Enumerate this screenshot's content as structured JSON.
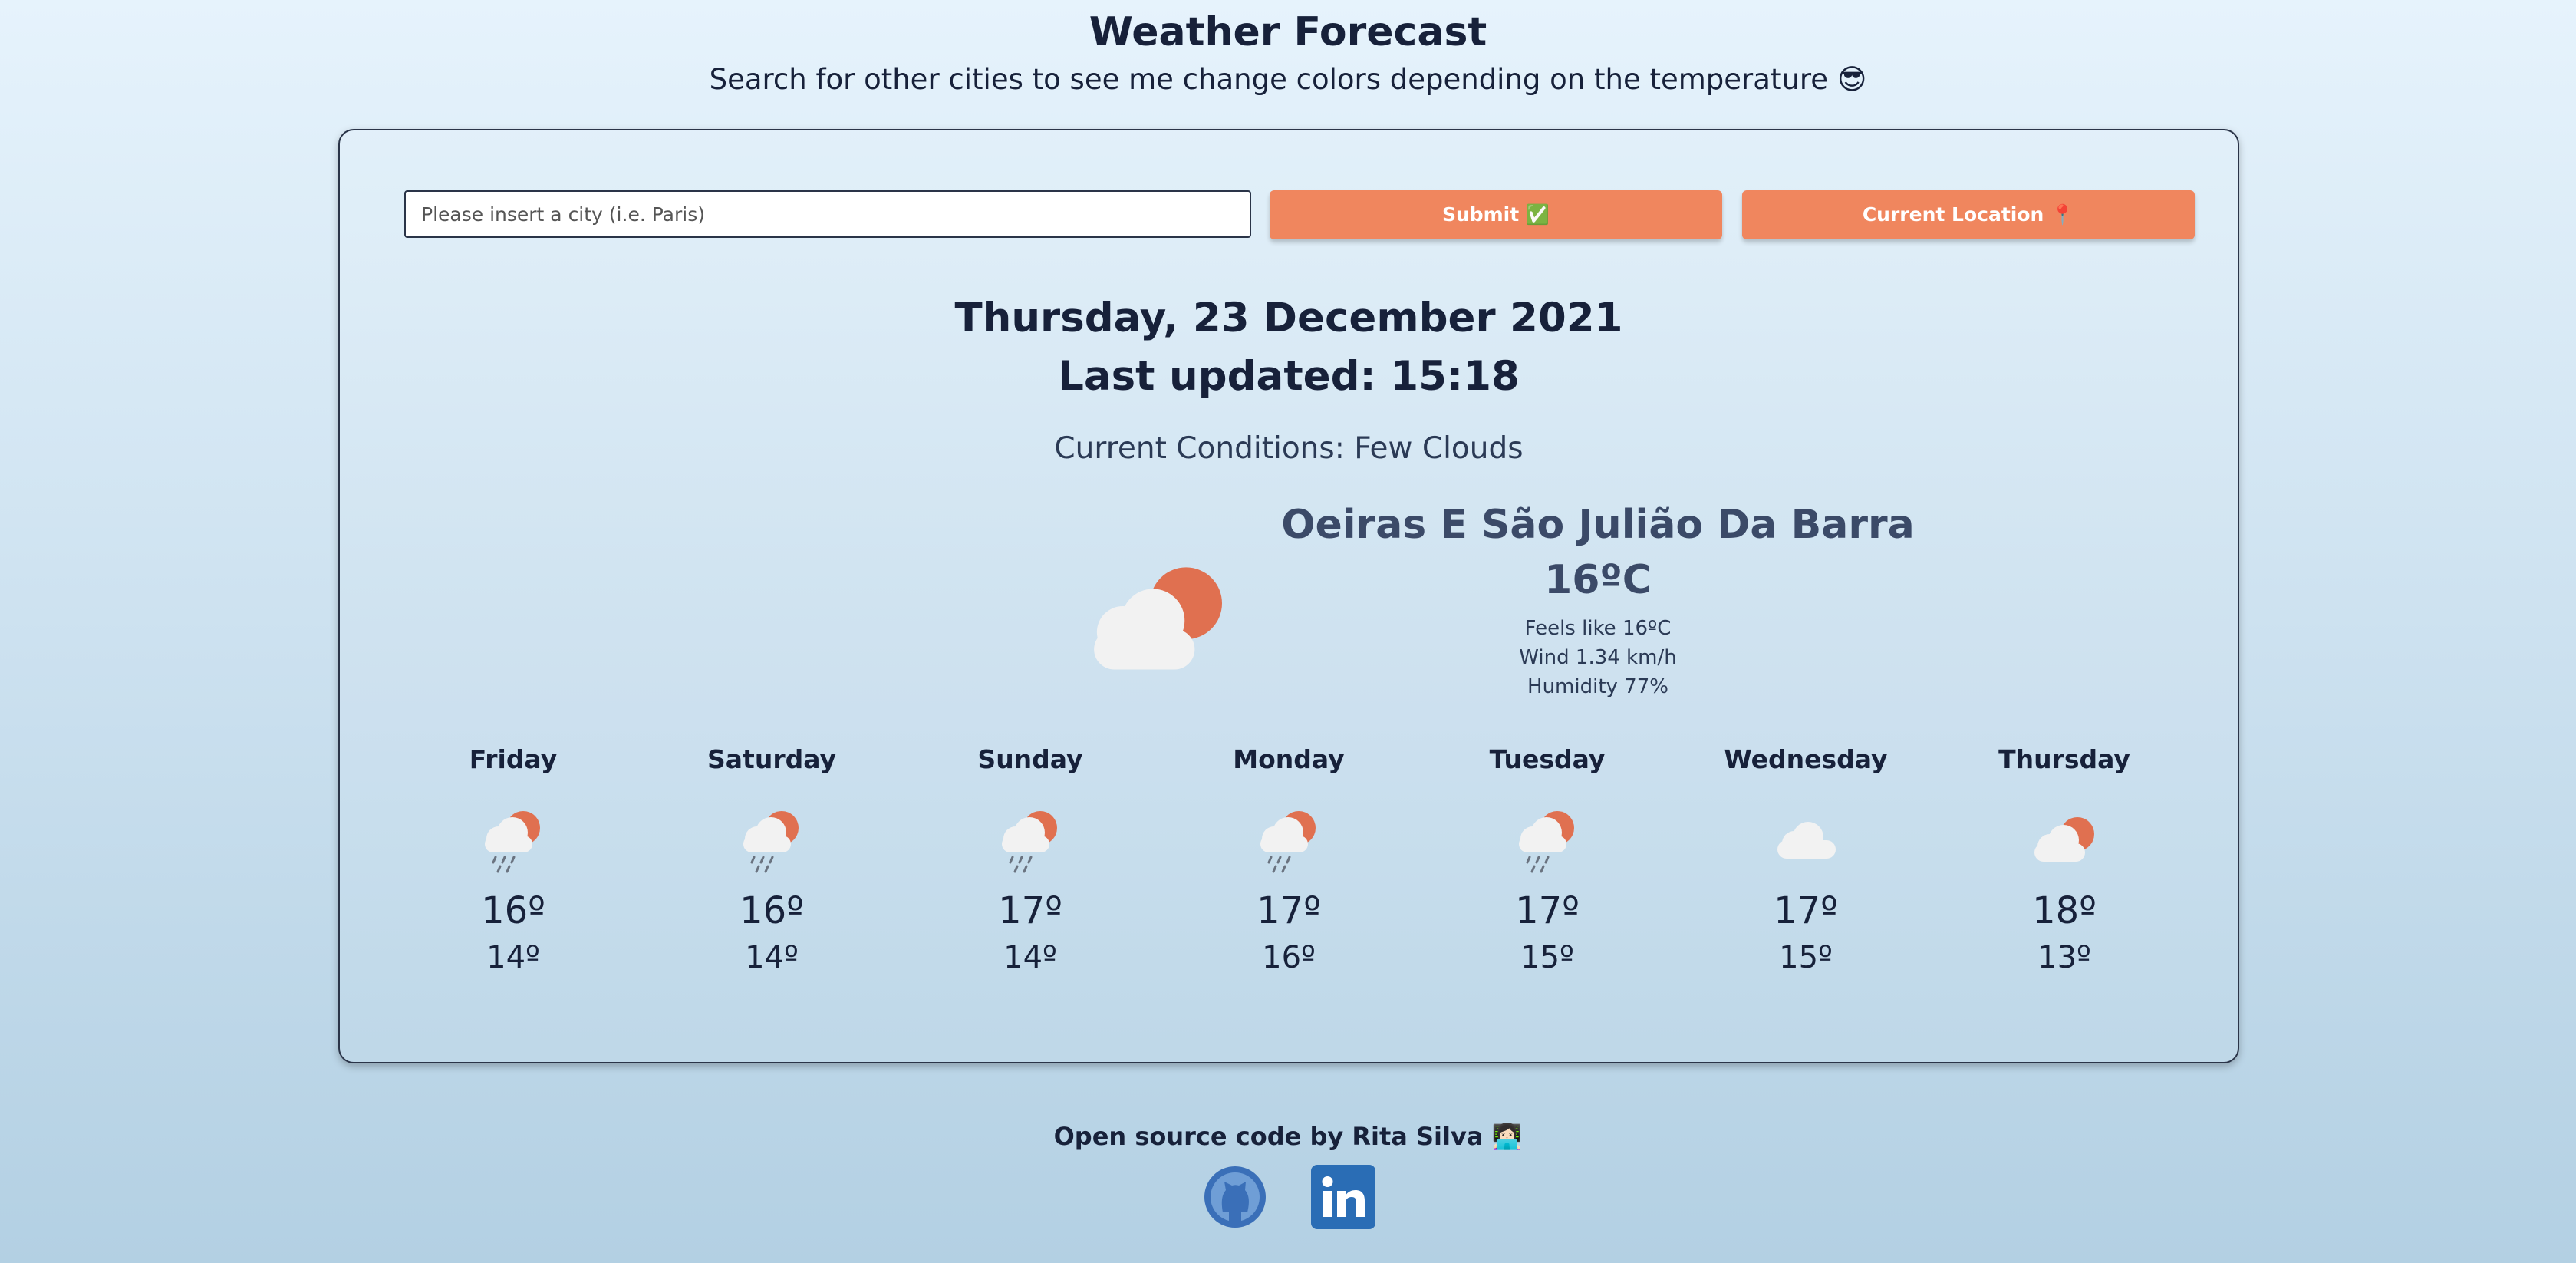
{
  "header": {
    "title": "Weather Forecast",
    "subtitle": "Search for other cities to see me change colors depending on the temperature 😎"
  },
  "search": {
    "placeholder": "Please insert a city (i.e. Paris)",
    "value": "",
    "submit_label": "Submit ✅",
    "location_label": "Current Location 📍"
  },
  "current": {
    "date": "Thursday, 23 December 2021",
    "last_updated": "Last updated: 15:18",
    "conditions": "Current Conditions: Few Clouds",
    "city": "Oeiras E São Julião Da Barra",
    "temperature": "16ºC",
    "feels_like": "Feels like 16ºC",
    "wind": "Wind 1.34 km/h",
    "humidity": "Humidity 77%",
    "icon": "few-clouds-day-icon"
  },
  "forecast": [
    {
      "day": "Friday",
      "max": "16º",
      "min": "14º",
      "icon": "rain-sun-icon"
    },
    {
      "day": "Saturday",
      "max": "16º",
      "min": "14º",
      "icon": "rain-sun-icon"
    },
    {
      "day": "Sunday",
      "max": "17º",
      "min": "14º",
      "icon": "rain-sun-icon"
    },
    {
      "day": "Monday",
      "max": "17º",
      "min": "16º",
      "icon": "rain-sun-icon"
    },
    {
      "day": "Tuesday",
      "max": "17º",
      "min": "15º",
      "icon": "rain-sun-icon"
    },
    {
      "day": "Wednesday",
      "max": "17º",
      "min": "15º",
      "icon": "cloud-icon"
    },
    {
      "day": "Thursday",
      "max": "18º",
      "min": "13º",
      "icon": "few-clouds-day-icon"
    }
  ],
  "footer": {
    "credit": "Open source code by Rita Silva 👩🏻‍💻",
    "github_icon": "github-icon",
    "linkedin_icon": "linkedin-icon"
  },
  "colors": {
    "accent": "#f0865e",
    "sun": "#e07050",
    "cloud": "#f2f2f2",
    "text": "#17213a",
    "linkedin": "#2a6db5",
    "github": "#3a6fb8"
  }
}
